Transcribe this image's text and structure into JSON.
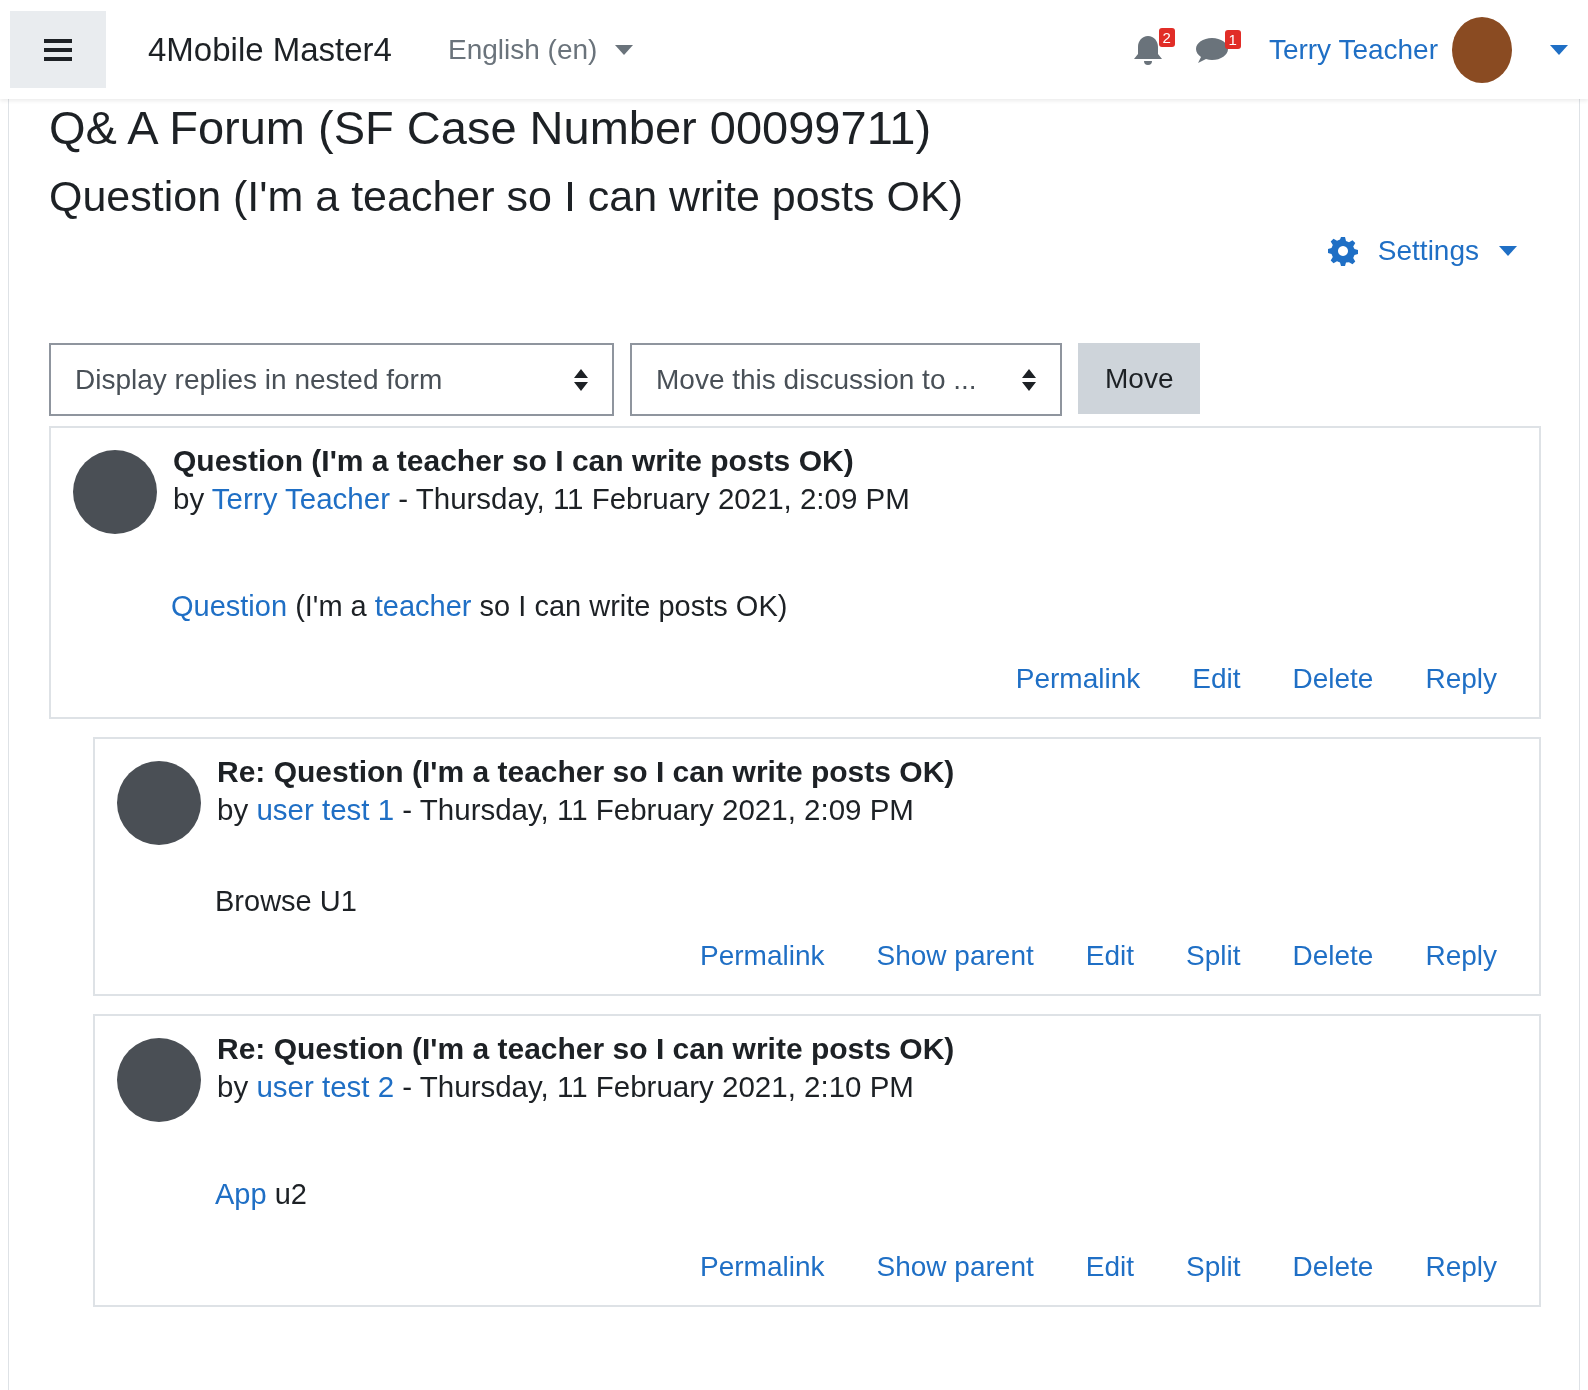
{
  "navbar": {
    "site_name": "4Mobile Master4",
    "language": "English (en)",
    "notifications": "2",
    "messages": "1",
    "user_name": "Terry Teacher"
  },
  "page": {
    "title": "Q& A Forum (SF Case Number 00099711)",
    "subtitle": "Question (I'm a teacher so I can write posts OK)",
    "settings_label": "Settings"
  },
  "controls": {
    "display_mode": "Display replies in nested form",
    "move_target": "Move this discussion to ...",
    "move_button": "Move"
  },
  "posts": [
    {
      "subject": "Question (I'm a teacher so I can write posts OK)",
      "by": "by",
      "author": "Terry Teacher",
      "date": "- Thursday, 11 February 2021, 2:09 PM",
      "message": [
        {
          "text": "Question",
          "link": true
        },
        {
          "text": " (I'm a ",
          "link": false
        },
        {
          "text": "teacher",
          "link": true
        },
        {
          "text": " so I can write posts OK)",
          "link": false
        }
      ],
      "actions": [
        "Permalink",
        "Edit",
        "Delete",
        "Reply"
      ],
      "children": [
        {
          "subject": "Re: Question (I'm a teacher so I can write posts OK)",
          "by": "by",
          "author": "user test 1",
          "date": "- Thursday, 11 February 2021, 2:09 PM",
          "message": [
            {
              "text": "Browse U1",
              "link": false
            }
          ],
          "actions": [
            "Permalink",
            "Show parent",
            "Edit",
            "Split",
            "Delete",
            "Reply"
          ]
        },
        {
          "subject": "Re: Question (I'm a teacher so I can write posts OK)",
          "by": "by",
          "author": "user test 2",
          "date": "- Thursday, 11 February 2021, 2:10 PM",
          "message": [
            {
              "text": "App",
              "link": true
            },
            {
              "text": " u2",
              "link": false
            }
          ],
          "actions": [
            "Permalink",
            "Show parent",
            "Edit",
            "Split",
            "Delete",
            "Reply"
          ]
        }
      ]
    }
  ]
}
